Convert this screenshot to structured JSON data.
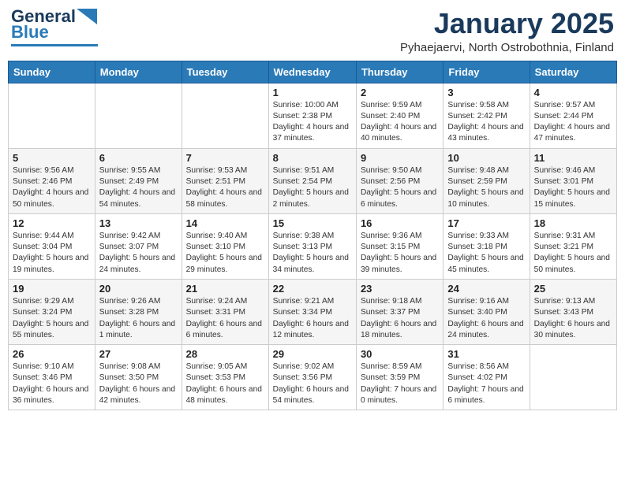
{
  "header": {
    "logo_general": "General",
    "logo_blue": "Blue",
    "month_title": "January 2025",
    "location": "Pyhaejaervi, North Ostrobothnia, Finland"
  },
  "days_of_week": [
    "Sunday",
    "Monday",
    "Tuesday",
    "Wednesday",
    "Thursday",
    "Friday",
    "Saturday"
  ],
  "weeks": [
    [
      {
        "day": "",
        "info": ""
      },
      {
        "day": "",
        "info": ""
      },
      {
        "day": "",
        "info": ""
      },
      {
        "day": "1",
        "info": "Sunrise: 10:00 AM\nSunset: 2:38 PM\nDaylight: 4 hours and 37 minutes."
      },
      {
        "day": "2",
        "info": "Sunrise: 9:59 AM\nSunset: 2:40 PM\nDaylight: 4 hours and 40 minutes."
      },
      {
        "day": "3",
        "info": "Sunrise: 9:58 AM\nSunset: 2:42 PM\nDaylight: 4 hours and 43 minutes."
      },
      {
        "day": "4",
        "info": "Sunrise: 9:57 AM\nSunset: 2:44 PM\nDaylight: 4 hours and 47 minutes."
      }
    ],
    [
      {
        "day": "5",
        "info": "Sunrise: 9:56 AM\nSunset: 2:46 PM\nDaylight: 4 hours and 50 minutes."
      },
      {
        "day": "6",
        "info": "Sunrise: 9:55 AM\nSunset: 2:49 PM\nDaylight: 4 hours and 54 minutes."
      },
      {
        "day": "7",
        "info": "Sunrise: 9:53 AM\nSunset: 2:51 PM\nDaylight: 4 hours and 58 minutes."
      },
      {
        "day": "8",
        "info": "Sunrise: 9:51 AM\nSunset: 2:54 PM\nDaylight: 5 hours and 2 minutes."
      },
      {
        "day": "9",
        "info": "Sunrise: 9:50 AM\nSunset: 2:56 PM\nDaylight: 5 hours and 6 minutes."
      },
      {
        "day": "10",
        "info": "Sunrise: 9:48 AM\nSunset: 2:59 PM\nDaylight: 5 hours and 10 minutes."
      },
      {
        "day": "11",
        "info": "Sunrise: 9:46 AM\nSunset: 3:01 PM\nDaylight: 5 hours and 15 minutes."
      }
    ],
    [
      {
        "day": "12",
        "info": "Sunrise: 9:44 AM\nSunset: 3:04 PM\nDaylight: 5 hours and 19 minutes."
      },
      {
        "day": "13",
        "info": "Sunrise: 9:42 AM\nSunset: 3:07 PM\nDaylight: 5 hours and 24 minutes."
      },
      {
        "day": "14",
        "info": "Sunrise: 9:40 AM\nSunset: 3:10 PM\nDaylight: 5 hours and 29 minutes."
      },
      {
        "day": "15",
        "info": "Sunrise: 9:38 AM\nSunset: 3:13 PM\nDaylight: 5 hours and 34 minutes."
      },
      {
        "day": "16",
        "info": "Sunrise: 9:36 AM\nSunset: 3:15 PM\nDaylight: 5 hours and 39 minutes."
      },
      {
        "day": "17",
        "info": "Sunrise: 9:33 AM\nSunset: 3:18 PM\nDaylight: 5 hours and 45 minutes."
      },
      {
        "day": "18",
        "info": "Sunrise: 9:31 AM\nSunset: 3:21 PM\nDaylight: 5 hours and 50 minutes."
      }
    ],
    [
      {
        "day": "19",
        "info": "Sunrise: 9:29 AM\nSunset: 3:24 PM\nDaylight: 5 hours and 55 minutes."
      },
      {
        "day": "20",
        "info": "Sunrise: 9:26 AM\nSunset: 3:28 PM\nDaylight: 6 hours and 1 minute."
      },
      {
        "day": "21",
        "info": "Sunrise: 9:24 AM\nSunset: 3:31 PM\nDaylight: 6 hours and 6 minutes."
      },
      {
        "day": "22",
        "info": "Sunrise: 9:21 AM\nSunset: 3:34 PM\nDaylight: 6 hours and 12 minutes."
      },
      {
        "day": "23",
        "info": "Sunrise: 9:18 AM\nSunset: 3:37 PM\nDaylight: 6 hours and 18 minutes."
      },
      {
        "day": "24",
        "info": "Sunrise: 9:16 AM\nSunset: 3:40 PM\nDaylight: 6 hours and 24 minutes."
      },
      {
        "day": "25",
        "info": "Sunrise: 9:13 AM\nSunset: 3:43 PM\nDaylight: 6 hours and 30 minutes."
      }
    ],
    [
      {
        "day": "26",
        "info": "Sunrise: 9:10 AM\nSunset: 3:46 PM\nDaylight: 6 hours and 36 minutes."
      },
      {
        "day": "27",
        "info": "Sunrise: 9:08 AM\nSunset: 3:50 PM\nDaylight: 6 hours and 42 minutes."
      },
      {
        "day": "28",
        "info": "Sunrise: 9:05 AM\nSunset: 3:53 PM\nDaylight: 6 hours and 48 minutes."
      },
      {
        "day": "29",
        "info": "Sunrise: 9:02 AM\nSunset: 3:56 PM\nDaylight: 6 hours and 54 minutes."
      },
      {
        "day": "30",
        "info": "Sunrise: 8:59 AM\nSunset: 3:59 PM\nDaylight: 7 hours and 0 minutes."
      },
      {
        "day": "31",
        "info": "Sunrise: 8:56 AM\nSunset: 4:02 PM\nDaylight: 7 hours and 6 minutes."
      },
      {
        "day": "",
        "info": ""
      }
    ]
  ]
}
